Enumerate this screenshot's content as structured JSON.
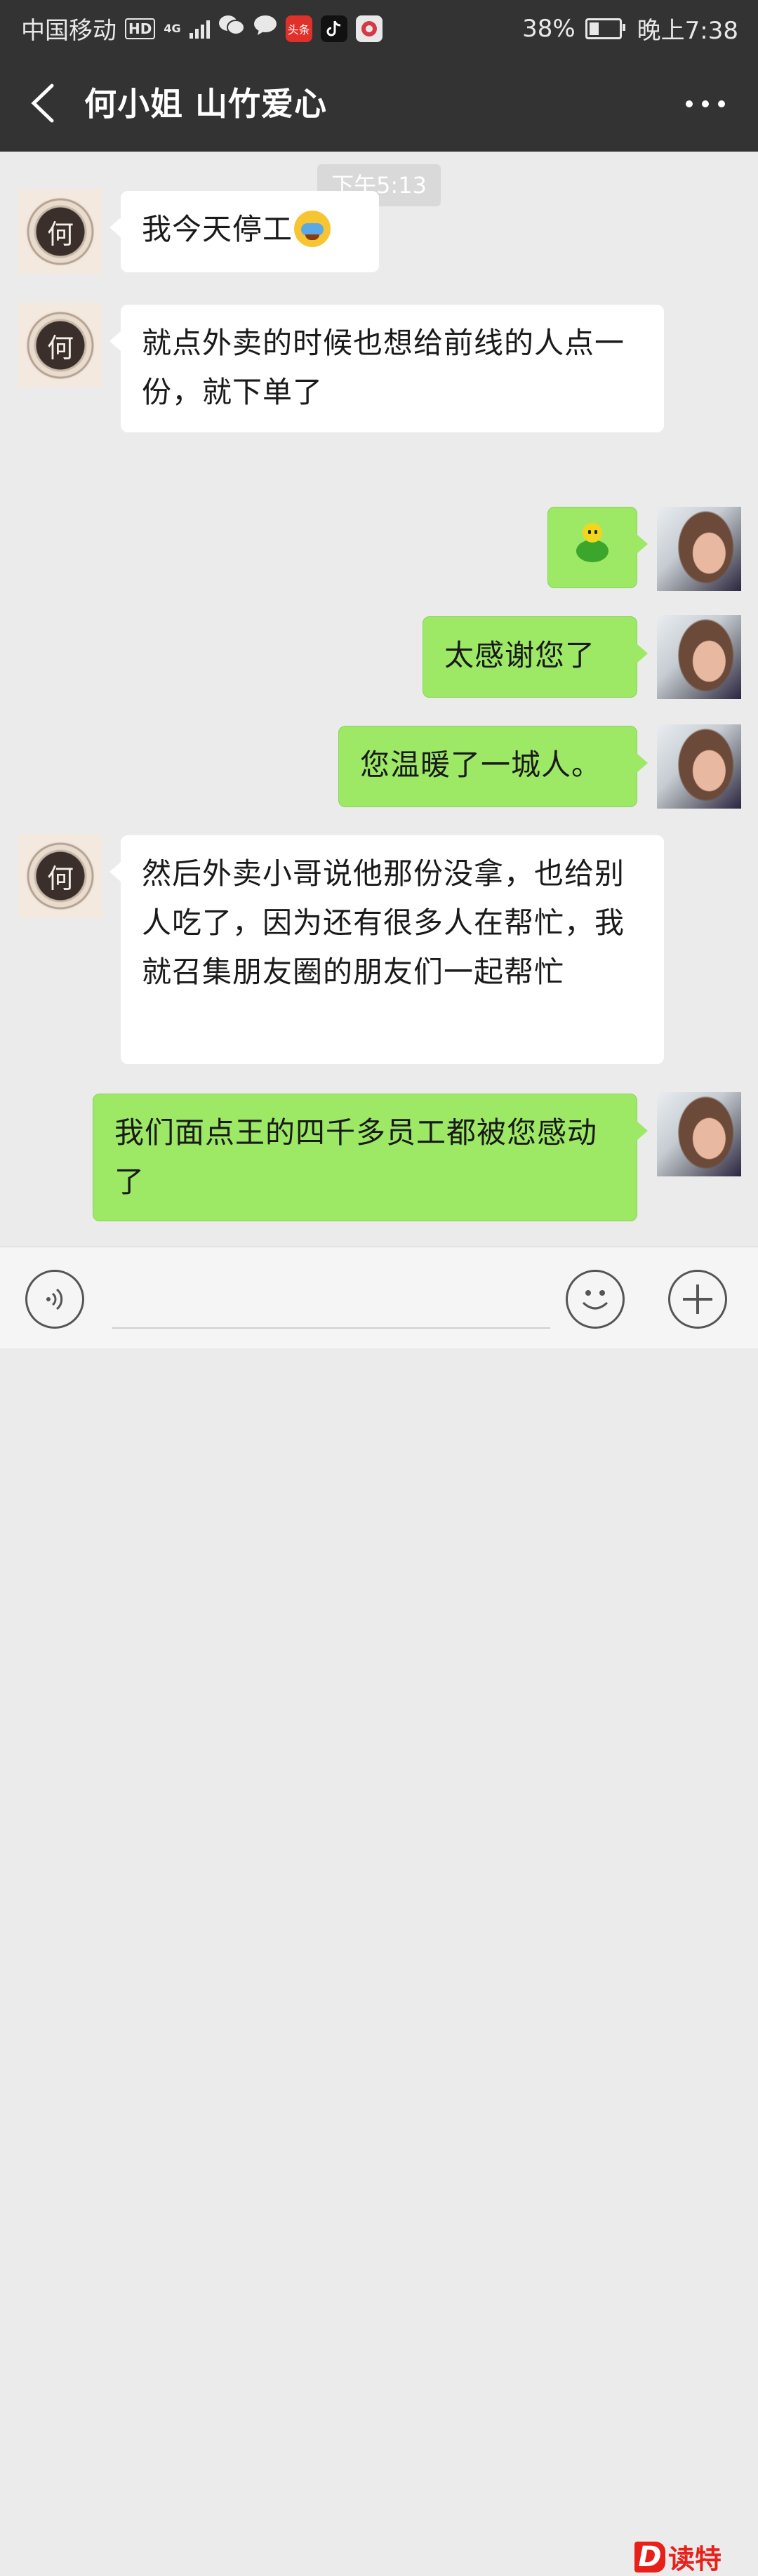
{
  "status_bar": {
    "carrier": "中国移动",
    "hd_badge": "HD",
    "network": "4G",
    "app_badge_toutiao": "头条",
    "battery": "38%",
    "battery_level": 0.38,
    "time": "晚上7:38"
  },
  "header": {
    "title": "何小姐 山竹爱心",
    "back_icon": "chevron-left-icon",
    "more_icon": "more-dots-icon"
  },
  "chat": {
    "time_label": "下午5:13",
    "contact_avatar_text": "何",
    "messages": [
      {
        "side": "in",
        "text": "我今天停工",
        "emoji": "crying-face"
      },
      {
        "side": "in",
        "text": "就点外卖的时候也想给前线的人点一份，就下单了"
      },
      {
        "side": "out",
        "emoji": "green-chick"
      },
      {
        "side": "out",
        "text": "太感谢您了"
      },
      {
        "side": "out",
        "text": "您温暖了一城人。"
      },
      {
        "side": "in",
        "text": "然后外卖小哥说他那份没拿，也给别人吃了，因为还有很多人在帮忙，我就召集朋友圈的朋友们一起帮忙"
      },
      {
        "side": "out",
        "text": "我们面点王的四千多员工都被您感动了"
      }
    ]
  },
  "input_bar": {
    "voice_icon": "voice-icon",
    "emoji_icon": "emoji-icon",
    "plus_icon": "plus-icon",
    "input_value": ""
  },
  "watermark": {
    "logo": "D",
    "text": "读特"
  },
  "colors": {
    "header_bg": "#333333",
    "chat_bg": "#ebebeb",
    "bubble_out": "#9de966",
    "bubble_in": "#ffffff",
    "watermark_red": "#e8201a"
  }
}
